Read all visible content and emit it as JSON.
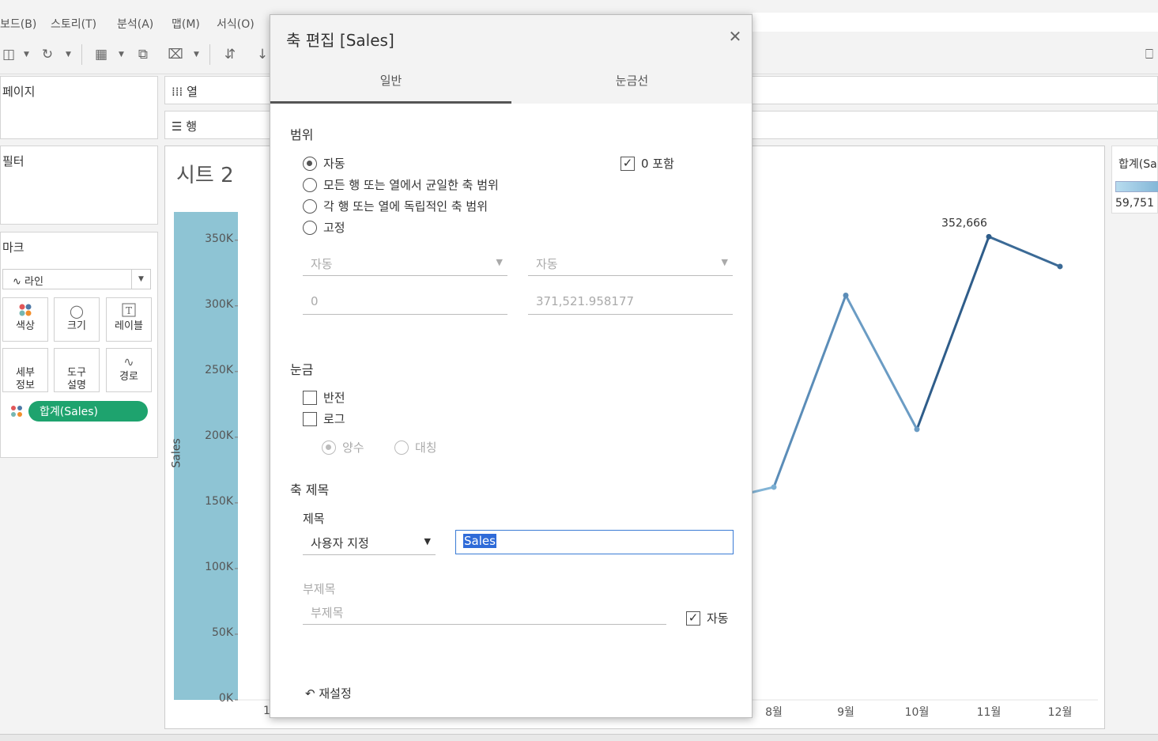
{
  "menu": [
    "보드(B)",
    "스토리(T)",
    "분석(A)",
    "맵(M)",
    "서식(O)"
  ],
  "panels": {
    "pages": "페이지",
    "filters": "필터",
    "marks": "마크",
    "mark_type": "라인",
    "mark_buttons": [
      {
        "label": "색상",
        "icon": "color-dots-icon"
      },
      {
        "label": "크기",
        "icon": "size-icon"
      },
      {
        "label": "레이블",
        "icon": "label-T-icon"
      },
      {
        "label": "세부\n정보",
        "icon": "none"
      },
      {
        "label": "도구\n설명",
        "icon": "none"
      },
      {
        "label": "경로",
        "icon": "path-line-icon"
      }
    ],
    "pill": "합계(Sales)"
  },
  "shelves": {
    "columns": "열",
    "rows": "행"
  },
  "sheet": {
    "title": "시트 2"
  },
  "legend": {
    "title": "합계(Sa",
    "min_value": "59,751"
  },
  "dialog": {
    "title": "축 편집 [Sales]",
    "tabs": [
      "일반",
      "눈금선"
    ],
    "range": {
      "section": "범위",
      "options": [
        "자동",
        "모든 행 또는 열에서 균일한 축 범위",
        "각 행 또는 열에 독립적인 축 범위",
        "고정"
      ],
      "selected": "자동",
      "include_zero": "0 포함",
      "start_mode": "자동",
      "end_mode": "자동",
      "start_value": "0",
      "end_value": "371,521.958177"
    },
    "scale": {
      "section": "눈금",
      "reversed": "반전",
      "log": "로그",
      "positive": "양수",
      "symmetric": "대칭"
    },
    "axis_title": {
      "section": "축 제목",
      "title_label": "제목",
      "title_mode": "사용자 지정",
      "title_value": "Sales",
      "subtitle_label": "부제목",
      "subtitle_placeholder": "부제목",
      "auto_label": "자동"
    },
    "reset": "재설정"
  },
  "chart_data": {
    "type": "line",
    "ylabel": "Sales",
    "ylim": [
      0,
      371521.958177
    ],
    "y_ticks": [
      "0K",
      "50K",
      "100K",
      "150K",
      "200K",
      "250K",
      "300K",
      "350K"
    ],
    "categories": [
      "8월",
      "9월",
      "10월",
      "11월",
      "12월"
    ],
    "values": [
      162000,
      308000,
      206000,
      352666,
      330000
    ],
    "data_labels": [
      {
        "category": "11월",
        "text": "352,666"
      }
    ],
    "partial_x_label": "1"
  }
}
